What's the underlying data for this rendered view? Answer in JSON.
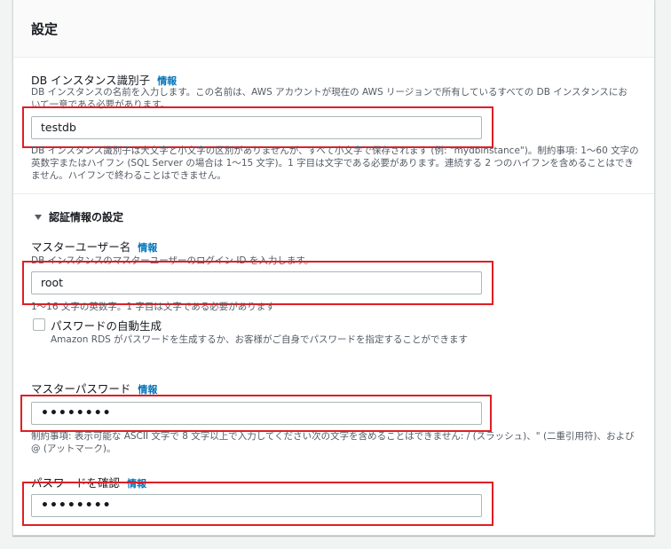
{
  "panel": {
    "title": "設定"
  },
  "db_identifier": {
    "label": "DB インスタンス識別子",
    "info": "情報",
    "description": "DB インスタンスの名前を入力します。この名前は、AWS アカウントが現在の AWS リージョンで所有しているすべての DB インスタンスにおいて一意である必要があります。",
    "value": "testdb",
    "constraint": "DB インスタンス識別子は大文字と小文字の区別がありませんが、すべて小文字で保存されます (例: \"mydbinstance\")。制約事項: 1〜60 文字の英数字またはハイフン (SQL Server の場合は 1〜15 文字)。1 字目は文字である必要があります。連続する 2 つのハイフンを含めることはできません。ハイフンで終わることはできません。"
  },
  "credentials": {
    "toggle_label": "認証情報の設定",
    "master_username": {
      "label": "マスターユーザー名",
      "info": "情報",
      "description": "DB インスタンスのマスターユーザーのログイン ID を入力します。",
      "value": "root",
      "constraint": "1〜16 文字の英数字。1 字目は文字である必要があります"
    },
    "auto_generate": {
      "label": "パスワードの自動生成",
      "checked": false,
      "description": "Amazon RDS がパスワードを生成するか、お客様がご自身でパスワードを指定することができます"
    },
    "master_password": {
      "label": "マスターパスワード",
      "info": "情報",
      "value": "••••••••",
      "constraint": "制約事項: 表示可能な ASCII 文字で 8 文字以上で入力してください次の文字を含めることはできません: / (スラッシュ)、\" (二重引用符)、および @ (アットマーク)。"
    },
    "confirm_password": {
      "label": "パスワードを確認",
      "info": "情報",
      "value": "••••••••"
    }
  },
  "colors": {
    "highlight": "#e01e25",
    "link": "#0073bb"
  }
}
